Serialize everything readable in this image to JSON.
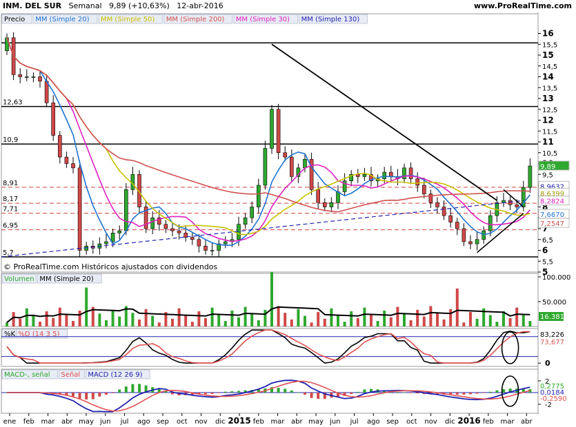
{
  "header": {
    "symbol": "INM. DEL SUR",
    "period": "Semanal",
    "price_change": "9,89 (+10,63%)",
    "date": "12-abr-2016",
    "site": "www.ProRealTime.com"
  },
  "price_panel": {
    "legend": [
      {
        "text": "Precio",
        "color": "#000000"
      },
      {
        "text": "MM (Simple 20)",
        "color": "#1e73d2"
      },
      {
        "text": "MM (Simple 50)",
        "color": "#c8c000"
      },
      {
        "text": "MM (Simple 200)",
        "color": "#d05050"
      },
      {
        "text": "MM (Simple 30)",
        "color": "#e020c0"
      },
      {
        "text": "MM (Simple 130)",
        "color": "#2020b0"
      }
    ],
    "footer_note": "© ProRealTime.com Históricos ajustados con dividendos",
    "y_ticks": [
      "16",
      "15,5",
      "15",
      "14,5",
      "14",
      "13,5",
      "13",
      "12,5",
      "12",
      "11,5",
      "11",
      "10,5",
      "10",
      "9,5",
      "9",
      "8,5",
      "8",
      "7,5",
      "7",
      "6,5",
      "6",
      "5,5",
      "5"
    ],
    "y_tick_values": [
      16,
      15.5,
      15,
      14.5,
      14,
      13.5,
      13,
      12.5,
      12,
      11.5,
      11,
      10.5,
      10,
      9.5,
      9,
      8.5,
      8,
      7.5,
      7,
      6.5,
      6,
      5.5,
      5
    ],
    "left_levels": [
      {
        "text": "12,63",
        "value": 12.63
      },
      {
        "text": "10,9",
        "value": 10.9
      },
      {
        "text": "8,91",
        "value": 8.91
      },
      {
        "text": "8,17",
        "value": 8.17
      },
      {
        "text": "7,71",
        "value": 7.71
      },
      {
        "text": "6,95",
        "value": 6.95
      },
      {
        "text": "5,7",
        "value": 5.7
      }
    ],
    "right_labels": [
      {
        "text": "9,89",
        "value": 9.89,
        "bg": "#2ea82e",
        "fg": "#ffffff"
      },
      {
        "text": "8,9632",
        "value": 8.96,
        "bg": "#ffffff",
        "fg": "#2020b0"
      },
      {
        "text": "8,6399",
        "value": 8.64,
        "bg": "#ffffff",
        "fg": "#a09800"
      },
      {
        "text": "8,2824",
        "value": 8.28,
        "bg": "#ffffff",
        "fg": "#e020c0"
      },
      {
        "text": "7,6670",
        "value": 7.67,
        "bg": "#ffffff",
        "fg": "#1e73d2"
      },
      {
        "text": "7,2547",
        "value": 7.25,
        "bg": "#ffffff",
        "fg": "#d05050"
      }
    ]
  },
  "volume_panel": {
    "legend": [
      {
        "text": "Volumen",
        "color": "#2ea82e"
      },
      {
        "text": "MM (Simple 20)",
        "color": "#000000"
      }
    ],
    "y_ticks": [
      "100.000",
      "50.000"
    ],
    "y_tick_values": [
      100000,
      50000
    ],
    "last_value": "16.381"
  },
  "stoch_panel": {
    "legend": [
      {
        "text": "%K",
        "color": "#000000"
      },
      {
        "text": "%D (14 3 5)",
        "color": "#e05050"
      }
    ],
    "y_ticks": [
      "0"
    ],
    "y_tick_values": [
      0
    ],
    "values": [
      "83,226",
      "73,677"
    ]
  },
  "macd_panel": {
    "legend": [
      {
        "text": "MACD-, señal",
        "color": "#2ea82e"
      },
      {
        "text": "Señal",
        "color": "#e05050"
      },
      {
        "text": "MACD (12 26 9)",
        "color": "#2020b0"
      }
    ],
    "y_ticks": [
      "2",
      "-2"
    ],
    "y_tick_values": [
      2,
      -2
    ],
    "values": [
      "0,2775",
      "0,0184",
      "-0,2590"
    ]
  },
  "x_axis": {
    "labels": [
      "ene",
      "feb",
      "mar",
      "abr",
      "may",
      "jun",
      "jul",
      "ago",
      "sep",
      "oct",
      "nov",
      "dic",
      "2015",
      "feb",
      "mar",
      "abr",
      "may",
      "jun",
      "jul",
      "ago",
      "sep",
      "oct",
      "nov",
      "dic",
      "2016",
      "feb",
      "mar",
      "abr"
    ],
    "bold": [
      "2015",
      "2016"
    ]
  },
  "chart_data": {
    "type": "candlestick",
    "title": "INM. DEL SUR",
    "ylim": [
      5,
      16
    ],
    "close_series": [
      15.8,
      14.1,
      14.0,
      14.0,
      14.0,
      13.8,
      12.8,
      11.3,
      10.3,
      10.0,
      9.8,
      6.0,
      6.2,
      6.1,
      6.3,
      6.4,
      6.8,
      6.9,
      8.8,
      9.5,
      8.0,
      7.0,
      7.5,
      7.2,
      7.0,
      6.9,
      6.8,
      6.6,
      6.5,
      6.2,
      6.0,
      6.0,
      6.3,
      6.4,
      6.5,
      7.2,
      7.5,
      8.0,
      9.0,
      10.7,
      12.5,
      10.5,
      10.3,
      9.4,
      9.8,
      10.2,
      8.8,
      8.2,
      8.0,
      8.2,
      8.7,
      9.2,
      9.5,
      9.4,
      9.5,
      9.2,
      9.3,
      9.6,
      9.4,
      9.3,
      9.8,
      9.3,
      9.0,
      8.6,
      8.2,
      8.0,
      7.6,
      7.3,
      7.0,
      6.4,
      6.3,
      6.5,
      6.9,
      7.6,
      8.2,
      8.3,
      8.1,
      8.0,
      8.9,
      9.89
    ]
  }
}
